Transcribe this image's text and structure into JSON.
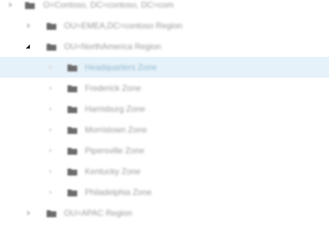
{
  "tree": {
    "root": {
      "label": "O=Contoso, DC=contoso, DC=com",
      "icon": "domain-folder-icon",
      "expanded": false
    },
    "regions": [
      {
        "label": "OU=EMEA,DC=contoso Region",
        "icon": "folder-icon",
        "expanded": false
      },
      {
        "label": "OU=NorthAmerica Region",
        "icon": "folder-icon",
        "expanded": true,
        "children": [
          {
            "label": "Headquarters Zone",
            "icon": "folder-icon",
            "selected": true
          },
          {
            "label": "Frederick Zone",
            "icon": "folder-icon",
            "selected": false
          },
          {
            "label": "Harrisburg Zone",
            "icon": "folder-icon",
            "selected": false
          },
          {
            "label": "Morristown Zone",
            "icon": "folder-icon",
            "selected": false
          },
          {
            "label": "Pipersville Zone",
            "icon": "folder-icon",
            "selected": false
          },
          {
            "label": "Kentucky Zone",
            "icon": "folder-icon",
            "selected": false
          },
          {
            "label": "Philadelphia Zone",
            "icon": "folder-icon",
            "selected": false
          }
        ]
      },
      {
        "label": "OU=APAC Region",
        "icon": "folder-icon",
        "expanded": false
      }
    ]
  },
  "colors": {
    "selection_background": "#e6f2f9",
    "folder_fill": "#6b6b6b",
    "text": "#9a9a9a"
  }
}
